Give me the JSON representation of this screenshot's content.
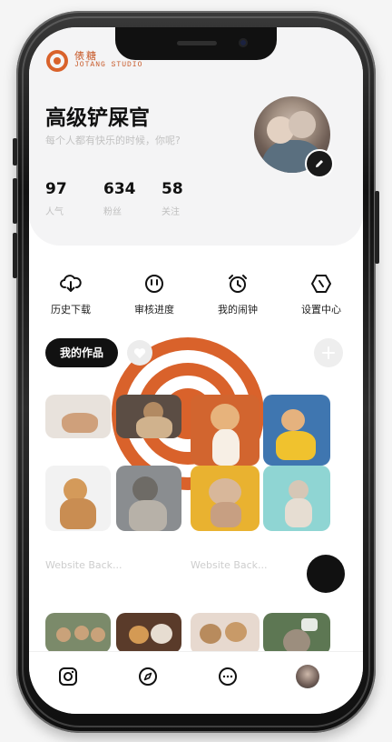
{
  "brand": {
    "name_cn": "俵糖",
    "name_en": "JOTANG STUDIO"
  },
  "profile": {
    "name": "高级铲屎官",
    "subtitle": "每个人都有快乐的时候，你呢?",
    "stats": [
      {
        "value": "97",
        "label": "人气"
      },
      {
        "value": "634",
        "label": "粉丝"
      },
      {
        "value": "58",
        "label": "关注"
      }
    ]
  },
  "actions": [
    {
      "icon": "cloud-download-icon",
      "label": "历史下载"
    },
    {
      "icon": "review-progress-icon",
      "label": "审核进度"
    },
    {
      "icon": "alarm-clock-icon",
      "label": "我的闹钟"
    },
    {
      "icon": "settings-hexagon-icon",
      "label": "设置中心"
    }
  ],
  "works": {
    "title": "我的作品",
    "captions": [
      "Website Back...",
      "Website Back..."
    ]
  },
  "colors": {
    "accent_dark": "#111111",
    "brand_orange": "#c85a2a",
    "muted_text": "#c2c2c2"
  },
  "nav": [
    "instagram-icon",
    "compass-icon",
    "chat-bubble-icon",
    "profile-avatar"
  ]
}
